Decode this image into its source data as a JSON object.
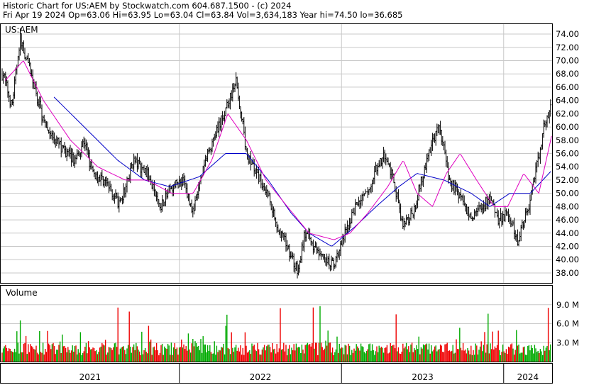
{
  "header": {
    "line1": "Historic Chart for US:AEM by Stockwatch.com 604.687.1500 - (c) 2024",
    "line2": "Fri Apr 19 2024   Op=63.06  Hi=63.95  Lo=63.04  Cl=63.84  Vol=3,634,183   Year hi=74.50   lo=36.685"
  },
  "chart_data": [
    {
      "type": "line",
      "title": "US:AEM",
      "y_ticks": [
        "74.00",
        "72.00",
        "70.00",
        "68.00",
        "66.00",
        "64.00",
        "62.00",
        "60.00",
        "58.00",
        "56.00",
        "54.00",
        "52.00",
        "50.00",
        "48.00",
        "46.00",
        "44.00",
        "42.00",
        "40.00",
        "38.00"
      ],
      "ylim": [
        36.5,
        75.5
      ],
      "x_years": [
        "2021",
        "2022",
        "2023",
        "2024"
      ],
      "price_keypoints": {
        "x": [
          "2020-12-01",
          "2020-12-20",
          "2021-01-08",
          "2021-02-01",
          "2021-03-05",
          "2021-04-10",
          "2021-05-10",
          "2021-06-01",
          "2021-06-20",
          "2021-07-15",
          "2021-08-05",
          "2021-08-20",
          "2021-09-20",
          "2021-10-20",
          "2021-11-18",
          "2021-12-15",
          "2022-01-10",
          "2022-02-01",
          "2022-03-01",
          "2022-04-12",
          "2022-05-10",
          "2022-06-01",
          "2022-07-01",
          "2022-07-20",
          "2022-08-10",
          "2022-09-01",
          "2022-09-25",
          "2022-10-10",
          "2022-11-01",
          "2022-11-20",
          "2022-12-15",
          "2023-01-10",
          "2023-02-01",
          "2023-03-01",
          "2023-03-20",
          "2023-04-10",
          "2023-05-01",
          "2023-05-20",
          "2023-06-10",
          "2023-07-01",
          "2023-07-20",
          "2023-08-10",
          "2023-09-01",
          "2023-10-01",
          "2023-10-20",
          "2023-11-10",
          "2023-12-01",
          "2023-12-20",
          "2024-01-10",
          "2024-02-01",
          "2024-02-28",
          "2024-03-15",
          "2024-04-01",
          "2024-04-19"
        ],
        "close": [
          68,
          63,
          73.5,
          68,
          60,
          57,
          55,
          58,
          53,
          52,
          50,
          48,
          55,
          53,
          48,
          51,
          52,
          47,
          55,
          62,
          67,
          56,
          52,
          50,
          45,
          42,
          38,
          44,
          42,
          40,
          39,
          44,
          48,
          50,
          54,
          56,
          51,
          45,
          47,
          52,
          57,
          60,
          52,
          49,
          46,
          48,
          49,
          46,
          47,
          43,
          48,
          54,
          60,
          63.84
        ]
      },
      "ma_fast_keypoints": {
        "x": [
          "2020-12-05",
          "2021-01-15",
          "2021-03-01",
          "2021-05-01",
          "2021-07-01",
          "2021-09-01",
          "2021-10-20",
          "2021-12-15",
          "2022-02-01",
          "2022-03-15",
          "2022-04-20",
          "2022-06-01",
          "2022-07-15",
          "2022-09-01",
          "2022-10-20",
          "2022-12-15",
          "2023-01-20",
          "2023-03-01",
          "2023-04-15",
          "2023-05-20",
          "2023-06-20",
          "2023-07-25",
          "2023-08-25",
          "2023-09-25",
          "2023-11-01",
          "2023-12-10",
          "2024-01-10",
          "2024-02-15",
          "2024-03-20",
          "2024-04-19"
        ],
        "y": [
          67,
          70,
          64,
          58,
          54,
          52,
          52,
          50,
          50,
          55,
          62,
          58,
          52,
          48,
          44,
          43,
          44,
          47,
          51,
          55,
          50,
          48,
          53,
          56,
          52,
          48,
          48,
          53,
          50,
          59
        ]
      },
      "ma_slow_keypoints": {
        "x": [
          "2021-03-25",
          "2021-06-01",
          "2021-08-15",
          "2021-10-15",
          "2021-12-10",
          "2022-02-15",
          "2022-04-15",
          "2022-06-01",
          "2022-07-20",
          "2022-09-10",
          "2022-10-20",
          "2022-12-10",
          "2023-02-01",
          "2023-03-20",
          "2023-05-10",
          "2023-06-20",
          "2023-08-20",
          "2023-10-20",
          "2023-12-01",
          "2024-01-15",
          "2024-03-01",
          "2024-04-19"
        ],
        "y": [
          64.5,
          60,
          55,
          52,
          51,
          52.5,
          56,
          56,
          52,
          47,
          44,
          42,
          45,
          48,
          51,
          53,
          52,
          50,
          48,
          50,
          50,
          53.5
        ]
      }
    },
    {
      "type": "bar",
      "title": "Volume",
      "y_ticks": [
        "9.0 M",
        "6.0 M",
        "3.0 M"
      ],
      "ylim": [
        0,
        12
      ],
      "bar_colors": [
        "#00aa00",
        "#ee0000"
      ]
    }
  ],
  "colors": {
    "price": "#000000",
    "ma_fast": "#e000c0",
    "ma_slow": "#0000c8",
    "vol_up": "#00aa00",
    "vol_down": "#ee0000",
    "grid": "#c8c8c8",
    "border": "#000000"
  }
}
